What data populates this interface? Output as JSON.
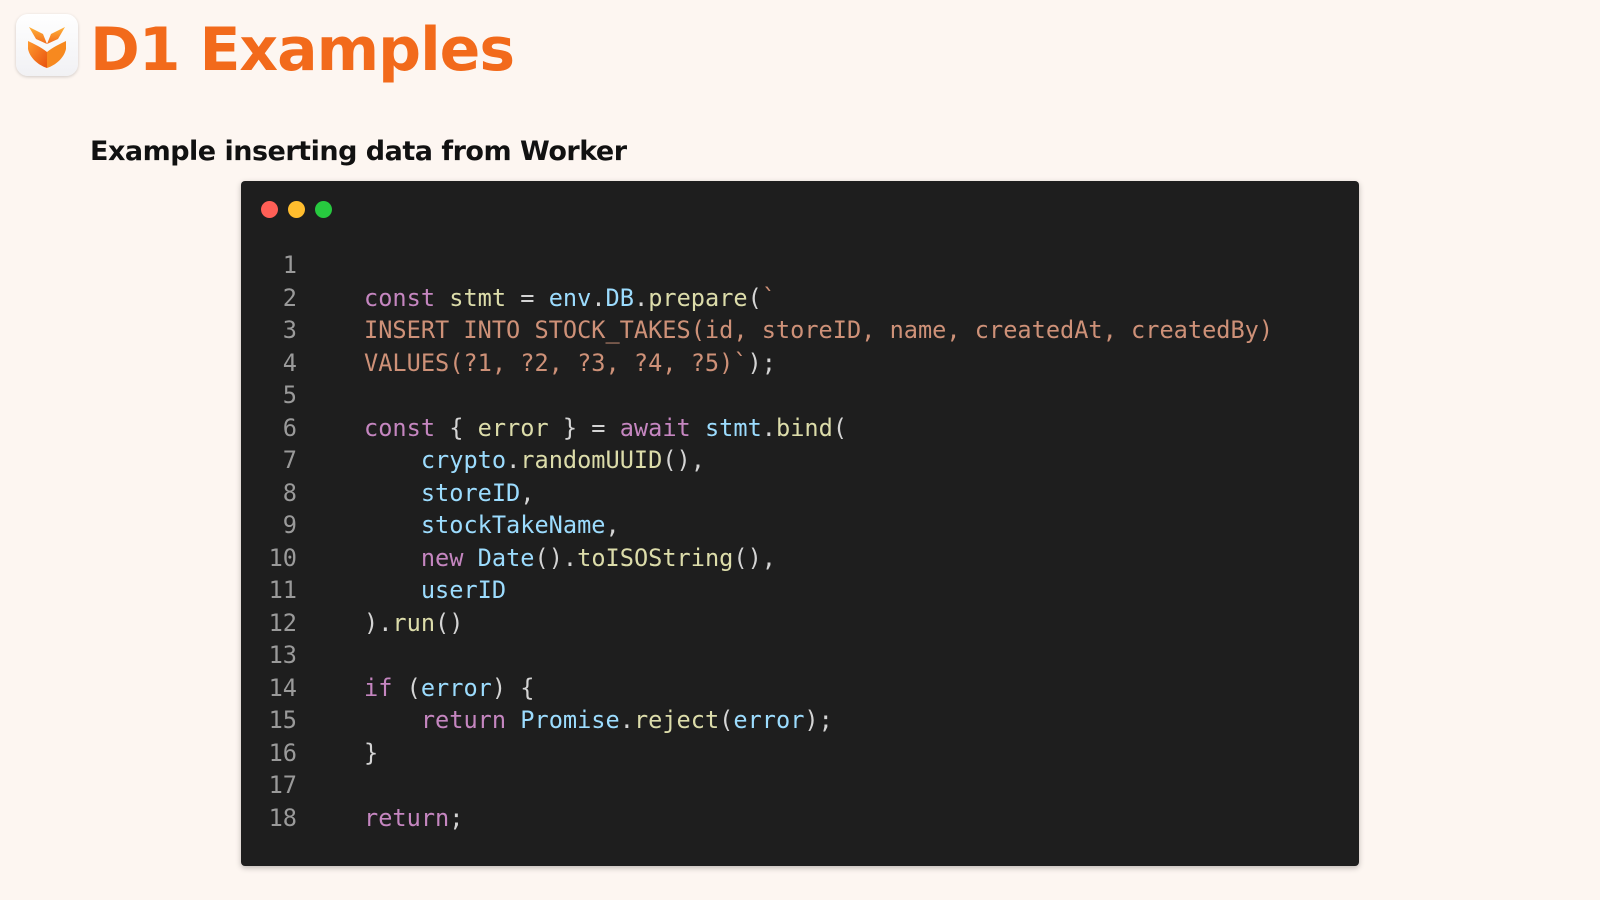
{
  "header": {
    "title": "D1 Examples",
    "logo_icon": "cloudflare-d1-logo-icon"
  },
  "slide": {
    "subtitle": "Example inserting data from Worker"
  },
  "code_window": {
    "window_controls": [
      "close-dot",
      "minimize-dot",
      "maximize-dot"
    ],
    "colors": {
      "background": "#1e1e1e",
      "close": "#ff5f56",
      "minimize": "#ffbd2e",
      "maximize": "#27c93f"
    },
    "line_numbers": [
      "1",
      "2",
      "3",
      "4",
      "5",
      "6",
      "7",
      "8",
      "9",
      "10",
      "11",
      "12",
      "13",
      "14",
      "15",
      "16",
      "17",
      "18"
    ],
    "lines": [
      [],
      [
        [
          "kw",
          "const"
        ],
        [
          "pn",
          " "
        ],
        [
          "fn",
          "stmt"
        ],
        [
          "pn",
          " = "
        ],
        [
          "vr",
          "env"
        ],
        [
          "pn",
          "."
        ],
        [
          "vr",
          "DB"
        ],
        [
          "pn",
          "."
        ],
        [
          "fn",
          "prepare"
        ],
        [
          "pn",
          "("
        ],
        [
          "st",
          "`"
        ]
      ],
      [
        [
          "st",
          "INSERT INTO STOCK_TAKES(id, storeID, name, createdAt, createdBy)"
        ]
      ],
      [
        [
          "st",
          "VALUES(?1, ?2, ?3, ?4, ?5)`"
        ],
        [
          "pn",
          ");"
        ]
      ],
      [],
      [
        [
          "kw",
          "const"
        ],
        [
          "pn",
          " { "
        ],
        [
          "fn",
          "error"
        ],
        [
          "pn",
          " } = "
        ],
        [
          "kw",
          "await"
        ],
        [
          "pn",
          " "
        ],
        [
          "vr",
          "stmt"
        ],
        [
          "pn",
          "."
        ],
        [
          "fn",
          "bind"
        ],
        [
          "pn",
          "("
        ]
      ],
      [
        [
          "pn",
          "    "
        ],
        [
          "vr",
          "crypto"
        ],
        [
          "pn",
          "."
        ],
        [
          "fn",
          "randomUUID"
        ],
        [
          "pn",
          "(),"
        ]
      ],
      [
        [
          "pn",
          "    "
        ],
        [
          "vr",
          "storeID"
        ],
        [
          "pn",
          ","
        ]
      ],
      [
        [
          "pn",
          "    "
        ],
        [
          "vr",
          "stockTakeName"
        ],
        [
          "pn",
          ","
        ]
      ],
      [
        [
          "pn",
          "    "
        ],
        [
          "kw",
          "new"
        ],
        [
          "pn",
          " "
        ],
        [
          "vr",
          "Date"
        ],
        [
          "pn",
          "()."
        ],
        [
          "fn",
          "toISOString"
        ],
        [
          "pn",
          "(),"
        ]
      ],
      [
        [
          "pn",
          "    "
        ],
        [
          "vr",
          "userID"
        ]
      ],
      [
        [
          "pn",
          ")."
        ],
        [
          "fn",
          "run"
        ],
        [
          "pn",
          "()"
        ]
      ],
      [],
      [
        [
          "kw",
          "if"
        ],
        [
          "pn",
          " ("
        ],
        [
          "vr",
          "error"
        ],
        [
          "pn",
          ") {"
        ]
      ],
      [
        [
          "pn",
          "    "
        ],
        [
          "kw",
          "return"
        ],
        [
          "pn",
          " "
        ],
        [
          "vr",
          "Promise"
        ],
        [
          "pn",
          "."
        ],
        [
          "fn",
          "reject"
        ],
        [
          "pn",
          "("
        ],
        [
          "vr",
          "error"
        ],
        [
          "pn",
          ");"
        ]
      ],
      [
        [
          "pn",
          "}"
        ]
      ],
      [],
      [
        [
          "kw",
          "return"
        ],
        [
          "pn",
          ";"
        ]
      ]
    ]
  }
}
